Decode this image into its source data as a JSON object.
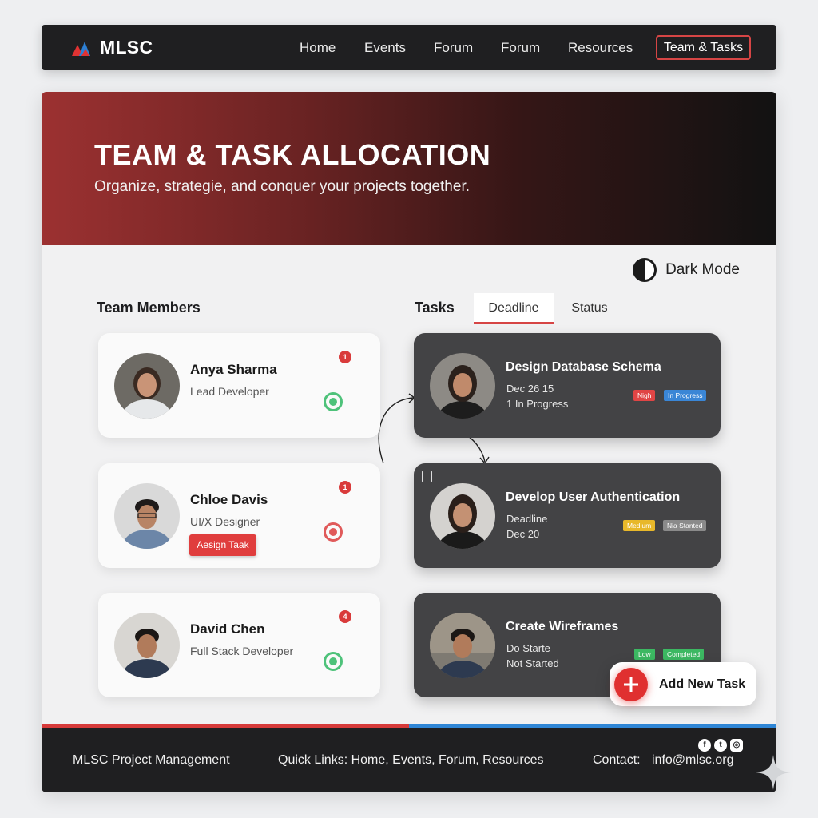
{
  "nav": {
    "brand": "MLSC",
    "links": [
      "Home",
      "Events",
      "Forum",
      "Forum",
      "Resources"
    ],
    "active": "Team & Tasks"
  },
  "hero": {
    "title": "TEAM & TASK ALLOCATION",
    "subtitle": "Organize, strategie, and conquer your projects together."
  },
  "dark_mode_label": "Dark Mode",
  "team": {
    "title": "Team Members",
    "members": [
      {
        "name": "Anya Sharma",
        "role": "Lead Developer",
        "badge": "1",
        "status": "green"
      },
      {
        "name": "Chloe Davis",
        "role": "UI/X Designer",
        "badge": "1",
        "status": "red",
        "action": "Aesign Taak"
      },
      {
        "name": "David Chen",
        "role": "Full Stack Developer",
        "badge": "4",
        "status": "green"
      }
    ]
  },
  "tasks": {
    "title": "Tasks",
    "tabs": [
      "Deadline",
      "Status"
    ],
    "items": [
      {
        "title": "Design Database Schema",
        "line1": "Dec 26 15",
        "line2": "1 In Progress",
        "priority": "Nigh",
        "status": "In Progress"
      },
      {
        "title": "Develop User Authentication",
        "line1": "Deadline",
        "line2": "Dec 20",
        "priority": "Medium",
        "status": "Nia Stanted"
      },
      {
        "title": "Create Wireframes",
        "line1": "Do Starte",
        "line2": "Not Started",
        "priority": "Low",
        "status": "Completed"
      }
    ]
  },
  "fab_label": "Add New Task",
  "footer": {
    "brand": "MLSC Project Management",
    "links": "Quick Links: Home, Events, Forum, Resources",
    "contact_label": "Contact:",
    "email": "info@mlsc.org"
  },
  "colors": {
    "accent": "#d64545",
    "nav_bg": "#1f1f21",
    "task_bg": "#434345",
    "priority_high": "#e04545",
    "priority_medium": "#e8b82a",
    "priority_low": "#3cb862",
    "status_progress": "#3a86d6",
    "status_notstarted": "#8a8a8a",
    "status_completed": "#3cb862"
  }
}
